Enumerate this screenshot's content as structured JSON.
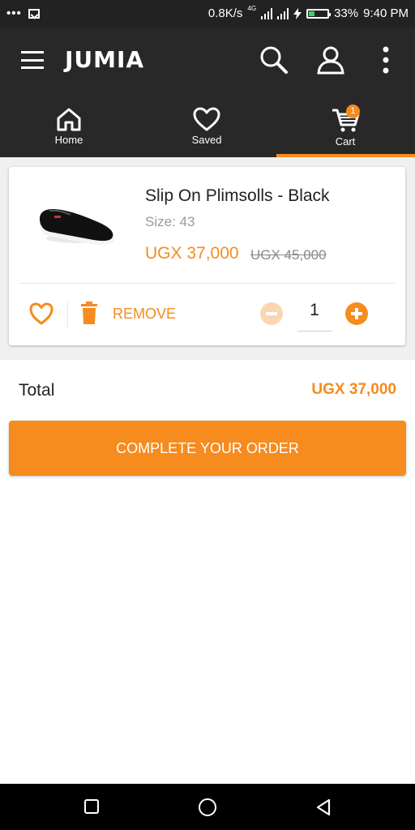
{
  "status_bar": {
    "dots": "•••",
    "net_speed": "0.8K/s",
    "network_type": "4G",
    "battery_percent": "33%",
    "battery_level": 0.33,
    "time": "9:40 PM"
  },
  "header": {
    "logo": "JUMIA",
    "icons": [
      "menu-icon",
      "search-icon",
      "account-icon",
      "more-vert-icon"
    ]
  },
  "nav": {
    "items": [
      {
        "label": "Home",
        "icon": "home-icon"
      },
      {
        "label": "Saved",
        "icon": "heart-icon"
      },
      {
        "label": "Cart",
        "icon": "cart-icon",
        "badge": "1",
        "active": true
      }
    ]
  },
  "cart": {
    "item": {
      "title": "Slip On Plimsolls - Black",
      "size": "Size: 43",
      "price": "UGX 37,000",
      "old_price": "UGX 45,000",
      "remove_label": "REMOVE",
      "quantity": "1"
    },
    "total_label": "Total",
    "total_value": "UGX 37,000",
    "complete_label": "COMPLETE YOUR ORDER"
  },
  "colors": {
    "accent": "#f68b1e",
    "header_bg": "#282828",
    "status_bg": "#222222"
  }
}
